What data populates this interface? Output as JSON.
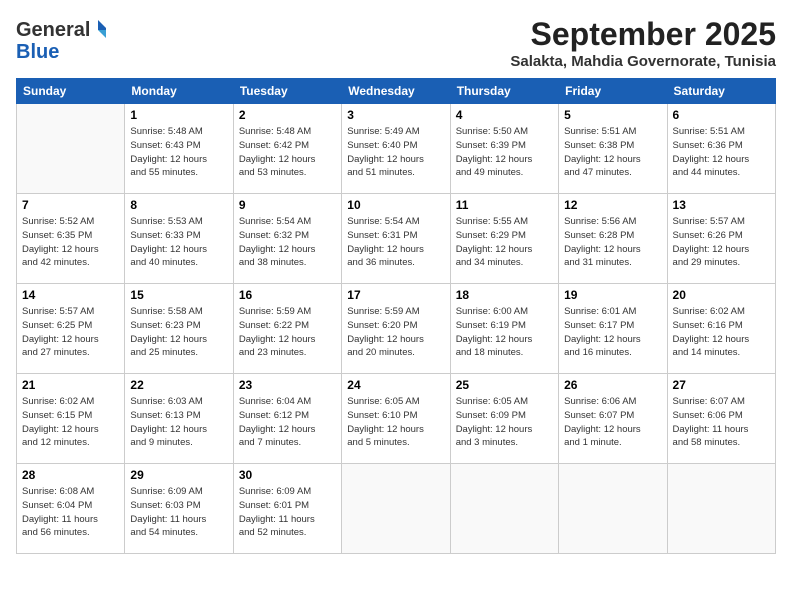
{
  "logo": {
    "general": "General",
    "blue": "Blue"
  },
  "header": {
    "month": "September 2025",
    "location": "Salakta, Mahdia Governorate, Tunisia"
  },
  "weekdays": [
    "Sunday",
    "Monday",
    "Tuesday",
    "Wednesday",
    "Thursday",
    "Friday",
    "Saturday"
  ],
  "weeks": [
    [
      {
        "day": "",
        "info": ""
      },
      {
        "day": "1",
        "info": "Sunrise: 5:48 AM\nSunset: 6:43 PM\nDaylight: 12 hours\nand 55 minutes."
      },
      {
        "day": "2",
        "info": "Sunrise: 5:48 AM\nSunset: 6:42 PM\nDaylight: 12 hours\nand 53 minutes."
      },
      {
        "day": "3",
        "info": "Sunrise: 5:49 AM\nSunset: 6:40 PM\nDaylight: 12 hours\nand 51 minutes."
      },
      {
        "day": "4",
        "info": "Sunrise: 5:50 AM\nSunset: 6:39 PM\nDaylight: 12 hours\nand 49 minutes."
      },
      {
        "day": "5",
        "info": "Sunrise: 5:51 AM\nSunset: 6:38 PM\nDaylight: 12 hours\nand 47 minutes."
      },
      {
        "day": "6",
        "info": "Sunrise: 5:51 AM\nSunset: 6:36 PM\nDaylight: 12 hours\nand 44 minutes."
      }
    ],
    [
      {
        "day": "7",
        "info": "Sunrise: 5:52 AM\nSunset: 6:35 PM\nDaylight: 12 hours\nand 42 minutes."
      },
      {
        "day": "8",
        "info": "Sunrise: 5:53 AM\nSunset: 6:33 PM\nDaylight: 12 hours\nand 40 minutes."
      },
      {
        "day": "9",
        "info": "Sunrise: 5:54 AM\nSunset: 6:32 PM\nDaylight: 12 hours\nand 38 minutes."
      },
      {
        "day": "10",
        "info": "Sunrise: 5:54 AM\nSunset: 6:31 PM\nDaylight: 12 hours\nand 36 minutes."
      },
      {
        "day": "11",
        "info": "Sunrise: 5:55 AM\nSunset: 6:29 PM\nDaylight: 12 hours\nand 34 minutes."
      },
      {
        "day": "12",
        "info": "Sunrise: 5:56 AM\nSunset: 6:28 PM\nDaylight: 12 hours\nand 31 minutes."
      },
      {
        "day": "13",
        "info": "Sunrise: 5:57 AM\nSunset: 6:26 PM\nDaylight: 12 hours\nand 29 minutes."
      }
    ],
    [
      {
        "day": "14",
        "info": "Sunrise: 5:57 AM\nSunset: 6:25 PM\nDaylight: 12 hours\nand 27 minutes."
      },
      {
        "day": "15",
        "info": "Sunrise: 5:58 AM\nSunset: 6:23 PM\nDaylight: 12 hours\nand 25 minutes."
      },
      {
        "day": "16",
        "info": "Sunrise: 5:59 AM\nSunset: 6:22 PM\nDaylight: 12 hours\nand 23 minutes."
      },
      {
        "day": "17",
        "info": "Sunrise: 5:59 AM\nSunset: 6:20 PM\nDaylight: 12 hours\nand 20 minutes."
      },
      {
        "day": "18",
        "info": "Sunrise: 6:00 AM\nSunset: 6:19 PM\nDaylight: 12 hours\nand 18 minutes."
      },
      {
        "day": "19",
        "info": "Sunrise: 6:01 AM\nSunset: 6:17 PM\nDaylight: 12 hours\nand 16 minutes."
      },
      {
        "day": "20",
        "info": "Sunrise: 6:02 AM\nSunset: 6:16 PM\nDaylight: 12 hours\nand 14 minutes."
      }
    ],
    [
      {
        "day": "21",
        "info": "Sunrise: 6:02 AM\nSunset: 6:15 PM\nDaylight: 12 hours\nand 12 minutes."
      },
      {
        "day": "22",
        "info": "Sunrise: 6:03 AM\nSunset: 6:13 PM\nDaylight: 12 hours\nand 9 minutes."
      },
      {
        "day": "23",
        "info": "Sunrise: 6:04 AM\nSunset: 6:12 PM\nDaylight: 12 hours\nand 7 minutes."
      },
      {
        "day": "24",
        "info": "Sunrise: 6:05 AM\nSunset: 6:10 PM\nDaylight: 12 hours\nand 5 minutes."
      },
      {
        "day": "25",
        "info": "Sunrise: 6:05 AM\nSunset: 6:09 PM\nDaylight: 12 hours\nand 3 minutes."
      },
      {
        "day": "26",
        "info": "Sunrise: 6:06 AM\nSunset: 6:07 PM\nDaylight: 12 hours\nand 1 minute."
      },
      {
        "day": "27",
        "info": "Sunrise: 6:07 AM\nSunset: 6:06 PM\nDaylight: 11 hours\nand 58 minutes."
      }
    ],
    [
      {
        "day": "28",
        "info": "Sunrise: 6:08 AM\nSunset: 6:04 PM\nDaylight: 11 hours\nand 56 minutes."
      },
      {
        "day": "29",
        "info": "Sunrise: 6:09 AM\nSunset: 6:03 PM\nDaylight: 11 hours\nand 54 minutes."
      },
      {
        "day": "30",
        "info": "Sunrise: 6:09 AM\nSunset: 6:01 PM\nDaylight: 11 hours\nand 52 minutes."
      },
      {
        "day": "",
        "info": ""
      },
      {
        "day": "",
        "info": ""
      },
      {
        "day": "",
        "info": ""
      },
      {
        "day": "",
        "info": ""
      }
    ]
  ]
}
